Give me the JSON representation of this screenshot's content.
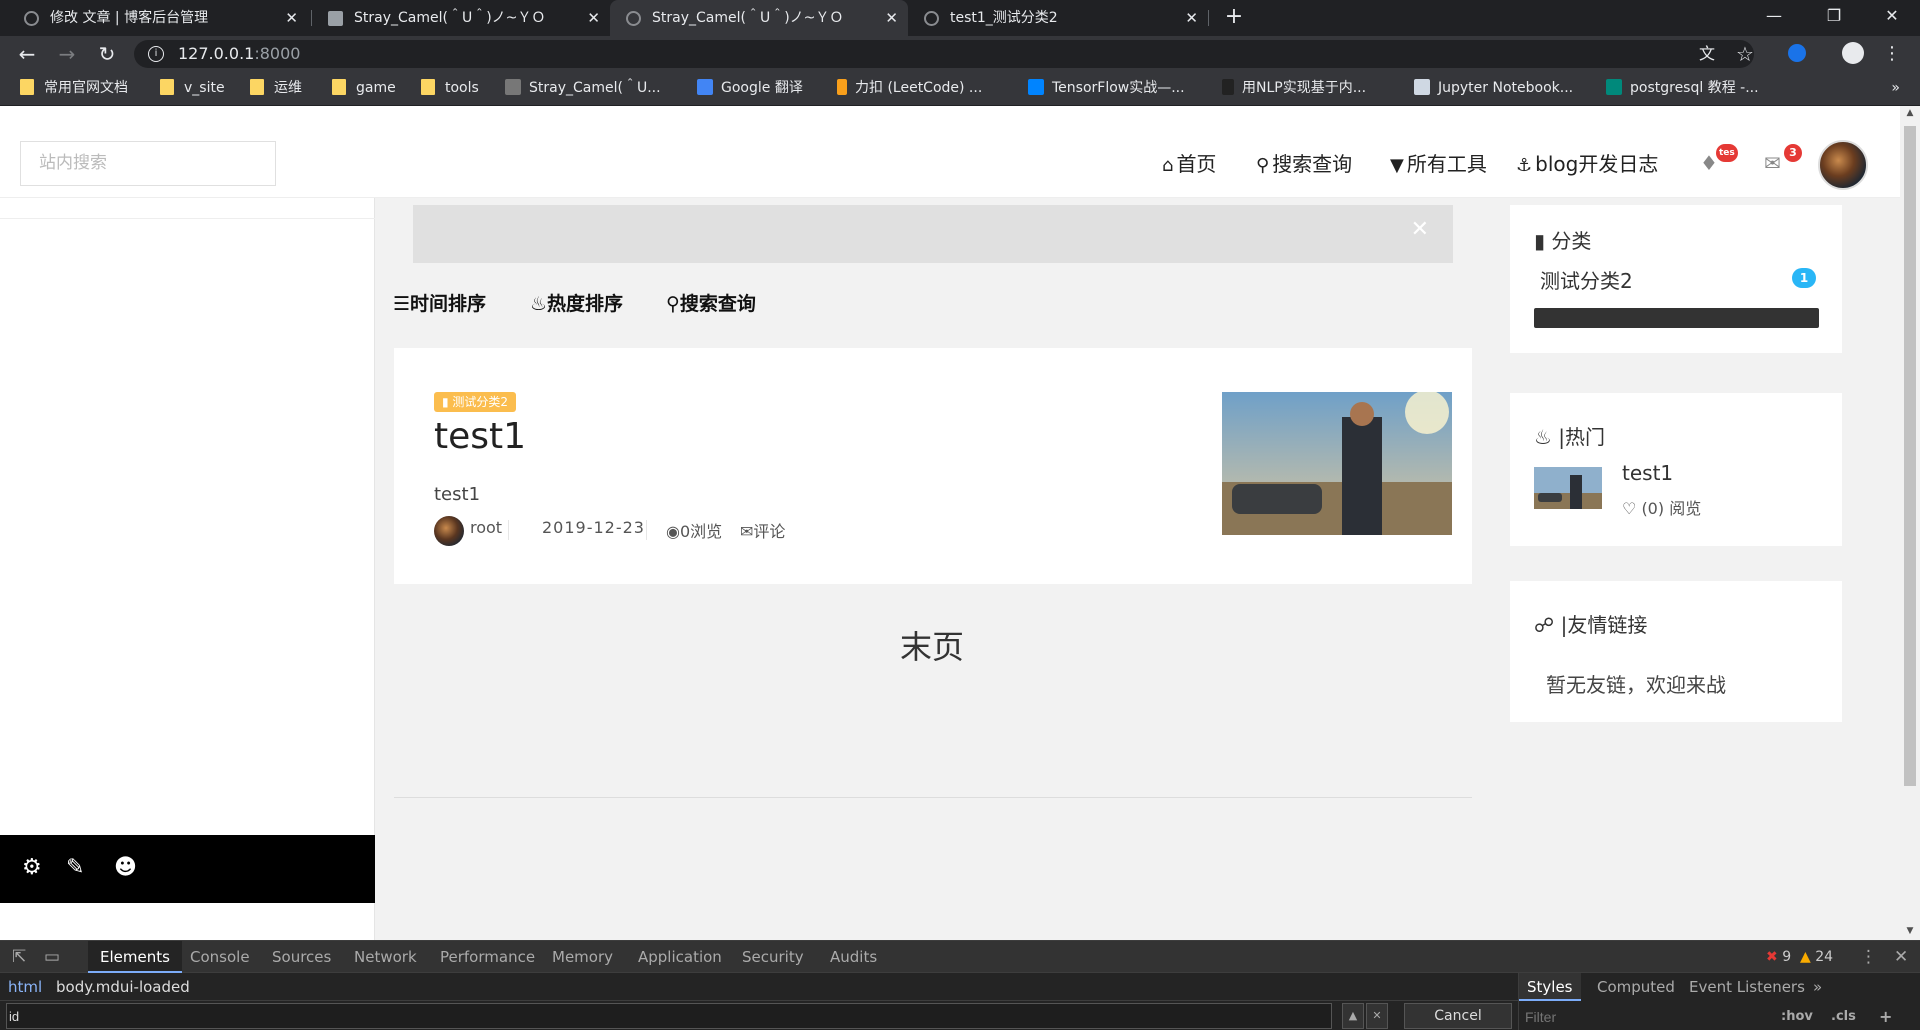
{
  "browser": {
    "tabs": [
      {
        "title": "修改 文章 | 博客后台管理",
        "close": "✕"
      },
      {
        "title": "Stray_Camel(＾U＾)ノ~ＹＯ",
        "close": "✕"
      },
      {
        "title": "Stray_Camel(＾U＾)ノ~ＹＯ",
        "close": "✕"
      },
      {
        "title": "test1_测试分类2",
        "close": "✕"
      }
    ],
    "active_tab_index": 2,
    "new_tab": "+",
    "url_host": "127.0.0.1",
    "url_port": ":8000",
    "bookmarks": [
      {
        "label": "常用官网文档",
        "icon": "folder-icon"
      },
      {
        "label": "v_site",
        "icon": "folder-icon"
      },
      {
        "label": "运维",
        "icon": "folder-icon"
      },
      {
        "label": "game",
        "icon": "folder-icon"
      },
      {
        "label": "tools",
        "icon": "folder-icon"
      },
      {
        "label": "Stray_Camel(＾U...",
        "icon": "site-icon"
      },
      {
        "label": "Google 翻译",
        "icon": "translate-icon"
      },
      {
        "label": "力扣 (LeetCode) ...",
        "icon": "leetcode-icon"
      },
      {
        "label": "TensorFlow实战—...",
        "icon": "zhihu-icon"
      },
      {
        "label": "用NLP实现基于内...",
        "icon": "n-icon"
      },
      {
        "label": "Jupyter Notebook...",
        "icon": "doc-icon"
      },
      {
        "label": "postgresql 教程 -...",
        "icon": "bing-icon"
      }
    ],
    "bookmarks_more": "»"
  },
  "site": {
    "search_placeholder": "站内搜索",
    "nav": [
      {
        "label": "首页",
        "icon": "home-icon"
      },
      {
        "label": "搜索查询",
        "icon": "search-icon"
      },
      {
        "label": "所有工具",
        "icon": "filter-icon"
      },
      {
        "label": "blog开发日志",
        "icon": "anchor-icon"
      }
    ],
    "notification_badge": "tes",
    "mail_badge": "3",
    "sort_tabs": [
      {
        "label": "时间排序",
        "icon": "list-icon"
      },
      {
        "label": "热度排序",
        "icon": "fire-icon"
      },
      {
        "label": "搜索查询",
        "icon": "search-icon"
      }
    ],
    "notice_close": "✕",
    "post": {
      "category": "测试分类2",
      "title": "test1",
      "summary": "test1",
      "author": "root",
      "date": "2019-12-23",
      "views": "0浏览",
      "comments": "评论"
    },
    "pager": "末页",
    "sidebar": {
      "categories_title": "分类",
      "category_name": "测试分类2",
      "category_count": "1",
      "hot_title": "|热门",
      "hot_post_title": "test1",
      "hot_post_meta": "(0) 阅览",
      "links_title": "|友情链接",
      "links_empty": "暂无友链，欢迎来战"
    }
  },
  "devtools": {
    "tabs": [
      "Elements",
      "Console",
      "Sources",
      "Network",
      "Performance",
      "Memory",
      "Application",
      "Security",
      "Audits"
    ],
    "active_tab": "Elements",
    "errors": "9",
    "warnings": "24",
    "crumbs": [
      "html",
      "body.mdui-loaded"
    ],
    "style_tabs": [
      "Styles",
      "Computed",
      "Event Listeners",
      "»"
    ],
    "find_value": "id",
    "cancel": "Cancel",
    "filter_placeholder": "Filter",
    "hov": ":hov",
    "cls": ".cls",
    "add": "+"
  },
  "colors": {
    "chip": "#fbbd4e",
    "count_badge": "#29b6f6",
    "red_badge": "#e53935"
  }
}
